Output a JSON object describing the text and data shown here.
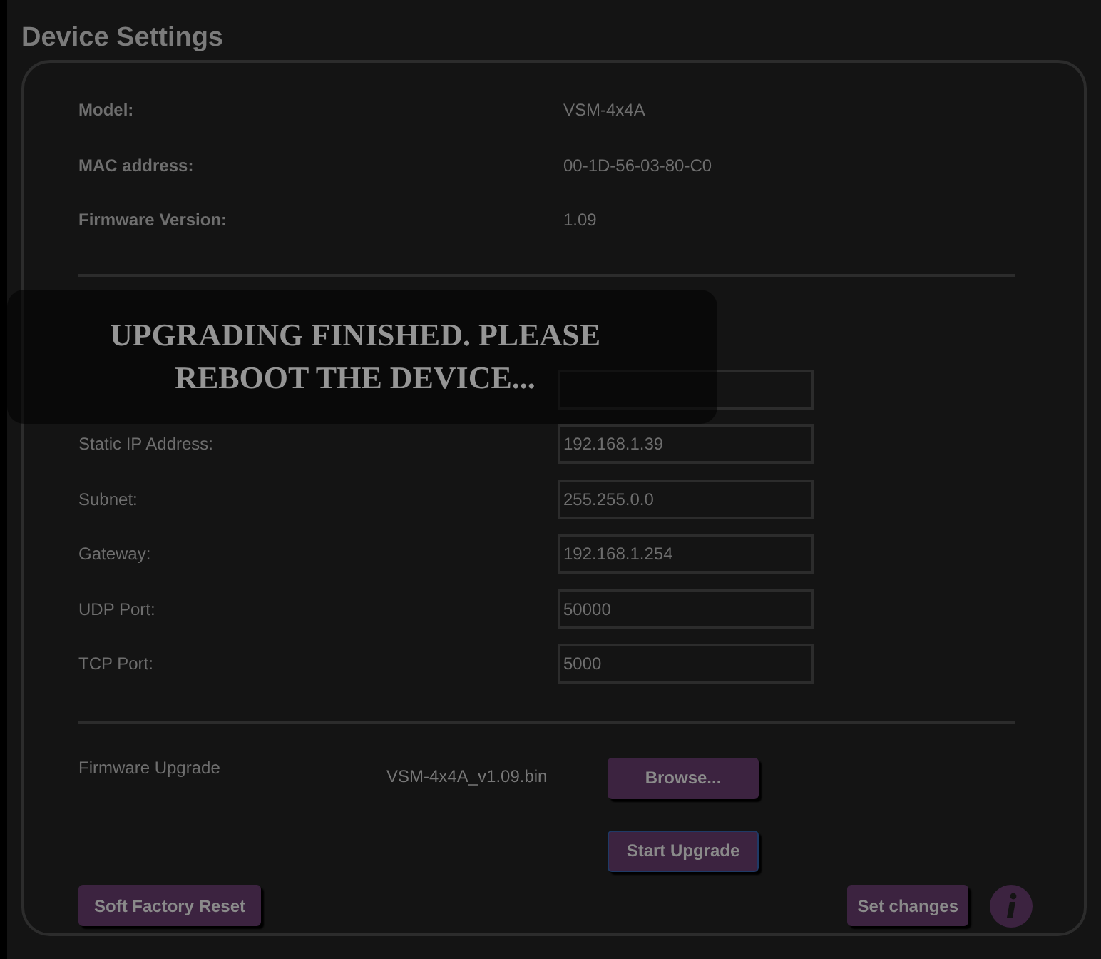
{
  "title": "Device Settings",
  "info": [
    {
      "label": "Model:",
      "value": "VSM-4x4A"
    },
    {
      "label": "MAC address:",
      "value": "00-1D-56-03-80-C0"
    },
    {
      "label": "Firmware Version:",
      "value": "1.09"
    }
  ],
  "network": [
    {
      "label": "Static IP Address:",
      "value": "192.168.1.39"
    },
    {
      "label": "Subnet:",
      "value": "255.255.0.0"
    },
    {
      "label": "Gateway:",
      "value": "192.168.1.254"
    },
    {
      "label": "UDP Port:",
      "value": "50000"
    },
    {
      "label": "TCP Port:",
      "value": "5000"
    }
  ],
  "firmware_upgrade": {
    "label": "Firmware Upgrade",
    "file": "VSM-4x4A_v1.09.bin",
    "browse": "Browse...",
    "start": "Start Upgrade"
  },
  "buttons": {
    "reset": "Soft Factory Reset",
    "set": "Set changes"
  },
  "notification": "UPGRADING FINISHED. PLEASE REBOOT THE DEVICE..."
}
